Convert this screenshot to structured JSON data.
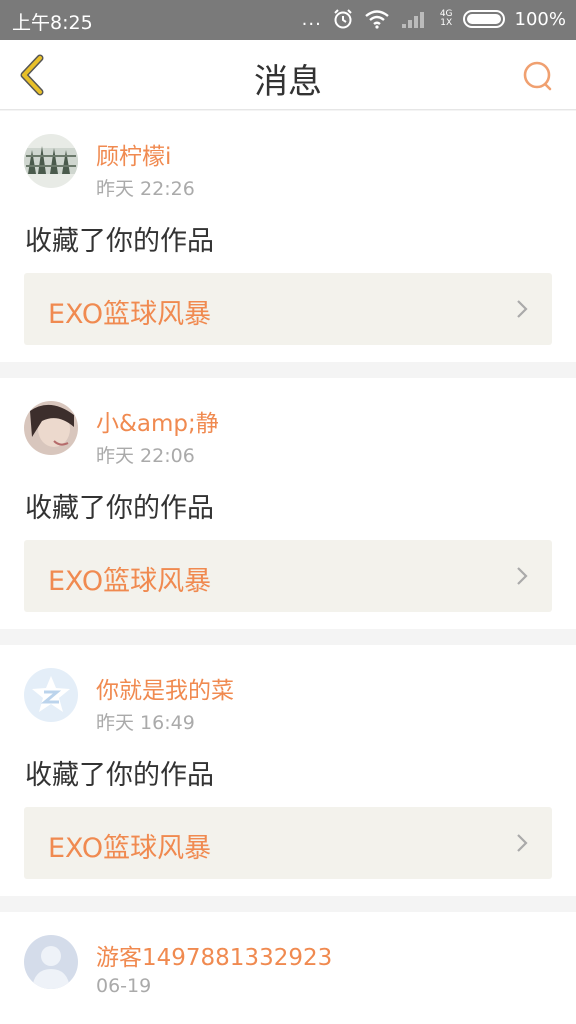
{
  "status_bar": {
    "time": "上午8:25",
    "dots": "...",
    "signal_label": "4G",
    "signal_sub": "1X",
    "battery": "100%"
  },
  "header": {
    "title": "消息"
  },
  "colors": {
    "accent": "#f08a50",
    "back_icon": "#e8b52a",
    "search_icon": "#f0a070"
  },
  "messages": [
    {
      "user": "顾柠檬i",
      "time": "昨天 22:26",
      "action": "收藏了你的作品",
      "work": "EXO篮球风暴",
      "avatar_icon": "photo-avatar-icon"
    },
    {
      "user": "小&amp;静",
      "time": "昨天 22:06",
      "action": "收藏了你的作品",
      "work": "EXO篮球风暴",
      "avatar_icon": "photo-avatar-icon"
    },
    {
      "user": "你就是我的菜",
      "time": "昨天 16:49",
      "action": "收藏了你的作品",
      "work": "EXO篮球风暴",
      "avatar_icon": "qzone-avatar-icon"
    },
    {
      "user": "游客1497881332923",
      "time": "06-19",
      "avatar_icon": "default-avatar-icon"
    }
  ]
}
